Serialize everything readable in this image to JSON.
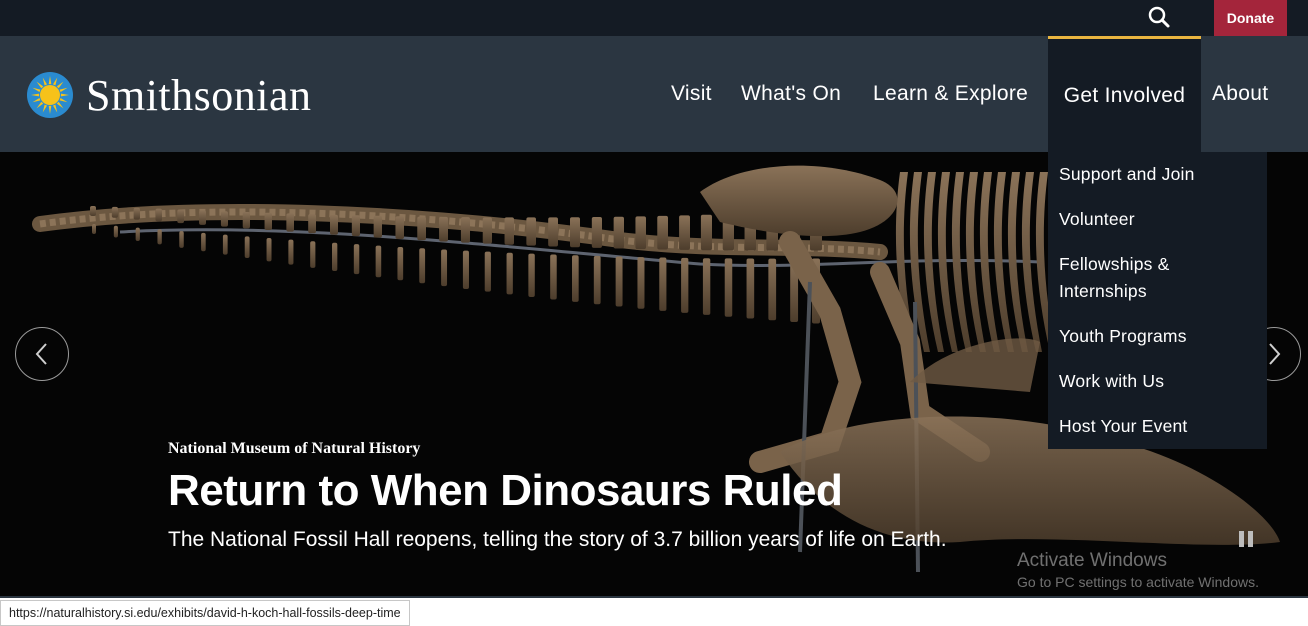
{
  "topbar": {
    "donate_label": "Donate",
    "search_icon": "search-icon"
  },
  "header": {
    "logo_text": "Smithsonian",
    "logo_icon": "sun-logo-icon",
    "nav": [
      {
        "label": "Visit"
      },
      {
        "label": "What's On"
      },
      {
        "label": "Learn & Explore"
      },
      {
        "label": "Get Involved",
        "active": true
      },
      {
        "label": "About"
      }
    ]
  },
  "dropdown": {
    "items": [
      {
        "label": "Support and Join"
      },
      {
        "label": "Volunteer"
      },
      {
        "label": "Fellowships & Internships"
      },
      {
        "label": "Youth Programs"
      },
      {
        "label": "Work with Us"
      },
      {
        "label": "Host Your Event"
      }
    ]
  },
  "hero": {
    "kicker": "National Museum of Natural History",
    "title": "Return to When Dinosaurs Ruled",
    "subtitle": "The National Fossil Hall reopens, telling the story of 3.7 billion years of life on Earth.",
    "prev_icon": "chevron-left-icon",
    "next_icon": "chevron-right-icon",
    "pause_icon": "pause-icon"
  },
  "os_watermark": {
    "line1": "Activate Windows",
    "line2": "Go to PC settings to activate Windows."
  },
  "status_bar": {
    "url": "https://naturalhistory.si.edu/exhibits/david-h-koch-hall-fossils-deep-time"
  },
  "colors": {
    "topbar_bg": "#141b24",
    "header_bg": "#2b3641",
    "donate_bg": "#a4253b",
    "active_accent": "#e9b540",
    "logo_sun": "#f6c21a",
    "logo_ring": "#2a8bd0"
  }
}
